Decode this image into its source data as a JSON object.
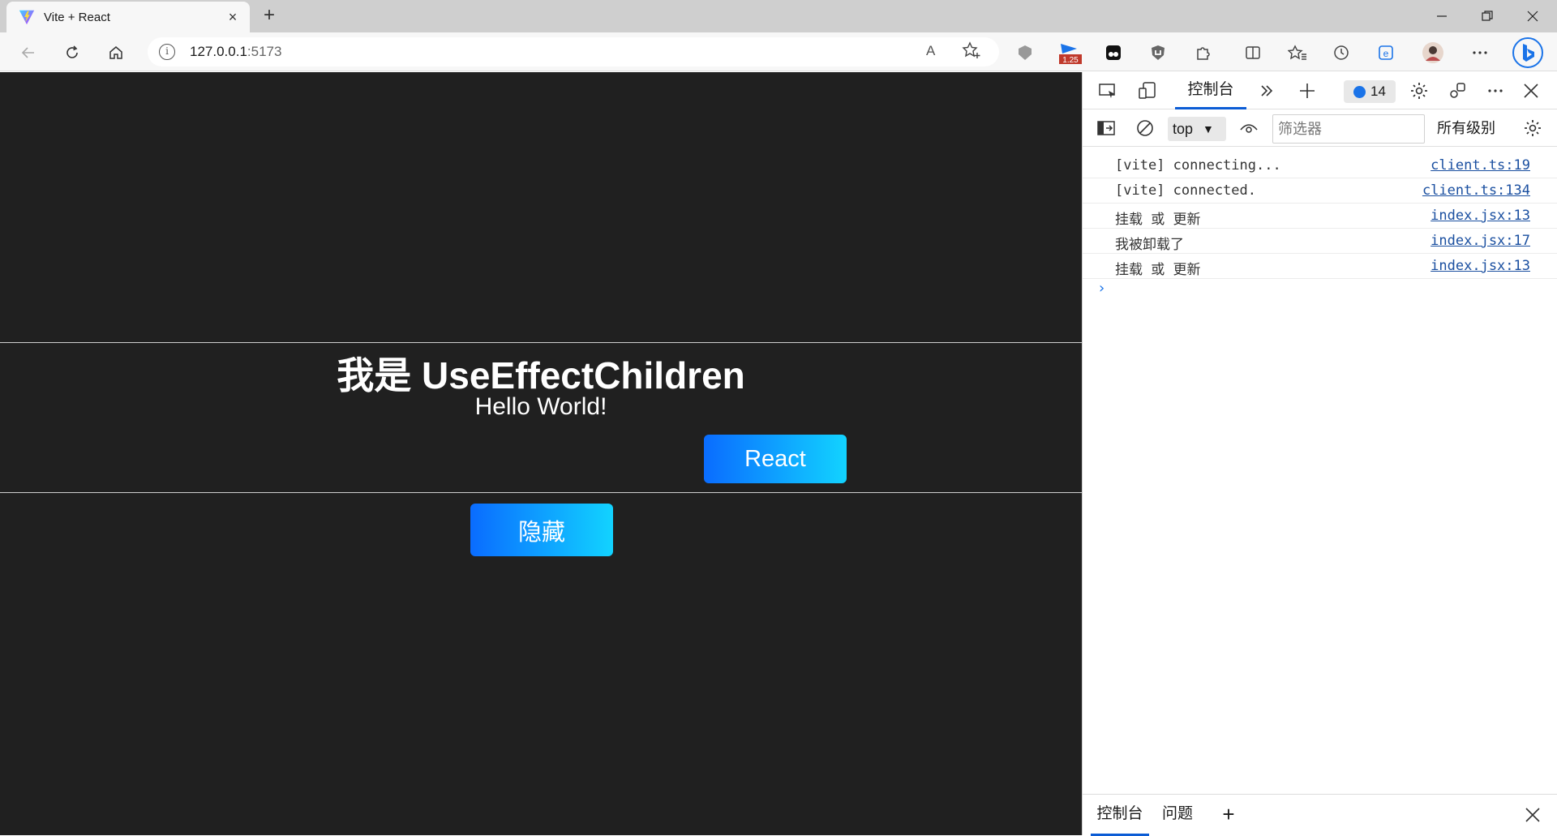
{
  "browser": {
    "tab_title": "Vite + React",
    "tab_close": "×",
    "new_tab": "+",
    "url_host": "127.0.0.1",
    "url_port": ":5173",
    "read_aloud_label": "A",
    "zoom_badge": "1.25"
  },
  "page": {
    "heading": "我是 UseEffectChildren",
    "subtext": "Hello World!",
    "react_button": "React",
    "hide_button": "隐藏",
    "background": "#202020",
    "button_gradient": [
      "#0a6cff",
      "#12d3ff"
    ]
  },
  "devtools": {
    "active_tab": "控制台",
    "issues_count": "14",
    "context": "top",
    "filter_placeholder": "筛选器",
    "levels": "所有级别",
    "console": [
      {
        "msg": "[vite] connecting...",
        "src": "client.ts:19"
      },
      {
        "msg": "[vite] connected.",
        "src": "client.ts:134"
      },
      {
        "msg": "挂载 或 更新",
        "src": "index.jsx:13"
      },
      {
        "msg": "我被卸载了",
        "src": "index.jsx:17"
      },
      {
        "msg": "挂载 或 更新",
        "src": "index.jsx:13"
      }
    ],
    "prompt": "›",
    "drawer_tabs": [
      "控制台",
      "问题"
    ],
    "drawer_add": "+",
    "link_color": "#1a4fa0",
    "accent": "#0b5cd5"
  }
}
